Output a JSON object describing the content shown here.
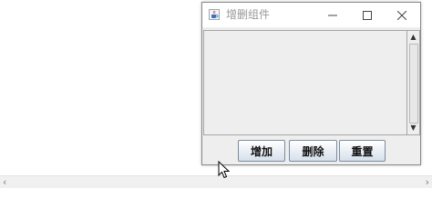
{
  "window": {
    "title": "增删组件",
    "icon": "java-cup-icon",
    "controls": {
      "minimize": "—",
      "maximize": "☐",
      "close": "✕"
    }
  },
  "buttons": {
    "add": "增加",
    "delete": "删除",
    "reset": "重置"
  },
  "scrollbar": {
    "up_arrow": "▲",
    "down_arrow": "▼"
  },
  "background": {
    "hscroll_left": "‹",
    "hscroll_right": "›"
  }
}
